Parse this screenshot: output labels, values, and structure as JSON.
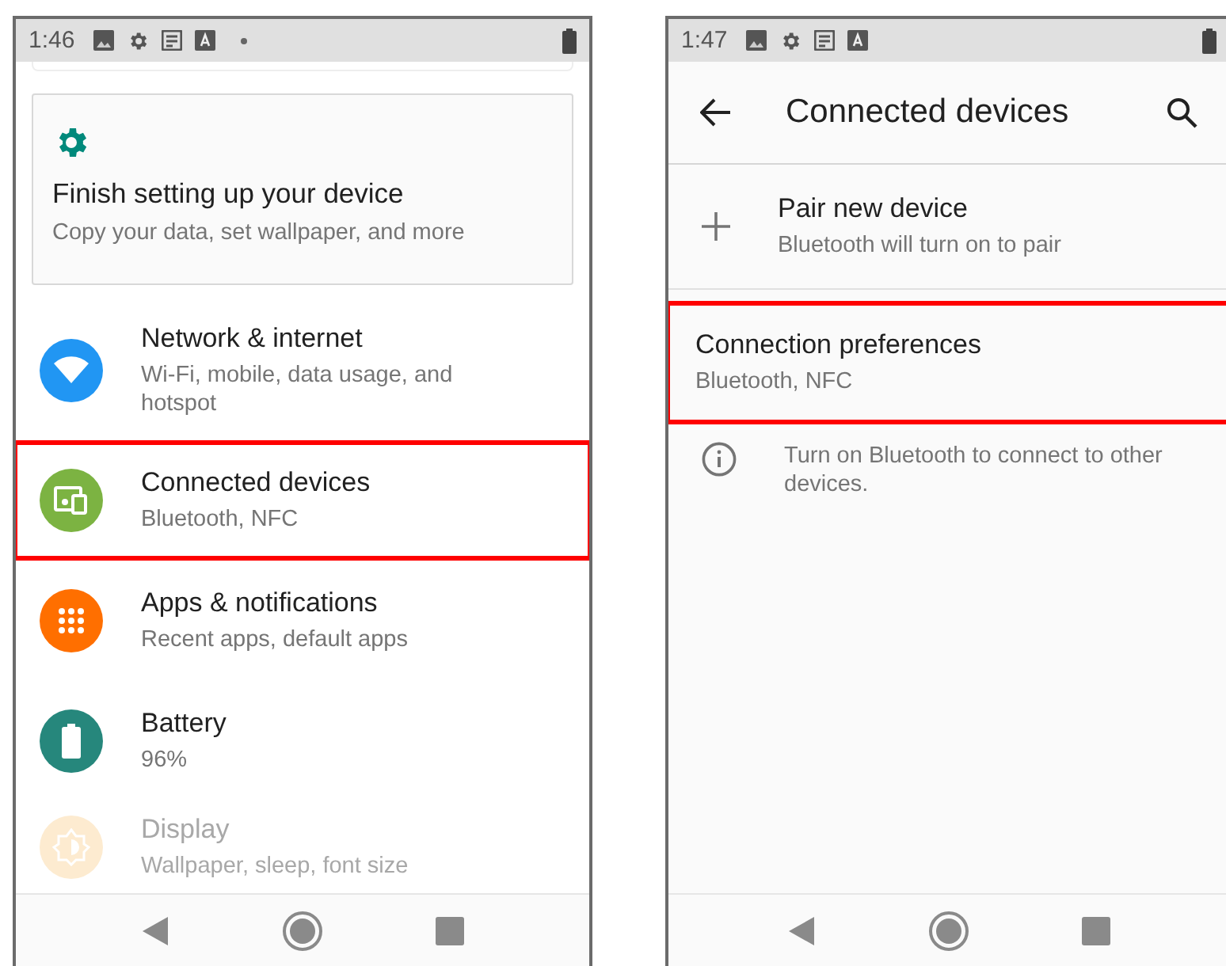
{
  "left_screen": {
    "status_bar": {
      "time": "1:46"
    },
    "suggestion_card": {
      "title": "Finish setting up your device",
      "subtitle": "Copy your data, set wallpaper, and more"
    },
    "items": [
      {
        "kind": "wifi",
        "title": "Network & internet",
        "subtitle": "Wi-Fi, mobile, data usage, and hotspot",
        "color": "#2196f3",
        "highlighted": false
      },
      {
        "kind": "devices",
        "title": "Connected devices",
        "subtitle": "Bluetooth, NFC",
        "color": "#7cb342",
        "highlighted": true
      },
      {
        "kind": "apps",
        "title": "Apps & notifications",
        "subtitle": "Recent apps, default apps",
        "color": "#ff6f00",
        "highlighted": false
      },
      {
        "kind": "battery",
        "title": "Battery",
        "subtitle": "96%",
        "color": "#26877c",
        "highlighted": false
      },
      {
        "kind": "display",
        "title": "Display",
        "subtitle": "Wallpaper, sleep, font size",
        "color": "#fdebd0",
        "highlighted": false,
        "dimmed": true
      }
    ]
  },
  "right_screen": {
    "status_bar": {
      "time": "1:47"
    },
    "app_bar": {
      "title": "Connected devices"
    },
    "items": [
      {
        "kind": "add",
        "title": "Pair new device",
        "subtitle": "Bluetooth will turn on to pair",
        "highlighted": false
      },
      {
        "kind": "plain",
        "title": "Connection preferences",
        "subtitle": "Bluetooth, NFC",
        "highlighted": true
      },
      {
        "kind": "info",
        "subtitle": "Turn on Bluetooth to connect to other devices."
      }
    ]
  }
}
